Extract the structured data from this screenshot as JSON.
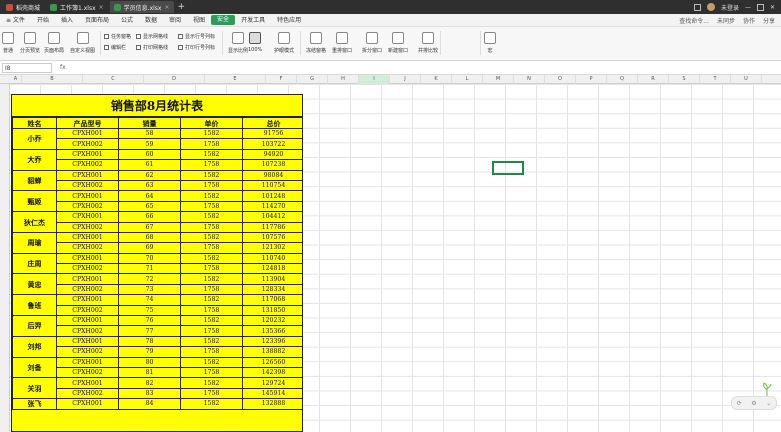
{
  "tabs": [
    {
      "label": "稻壳商城"
    },
    {
      "label": "工作簿1.xlsx"
    },
    {
      "label": "学员信息.xlsx"
    }
  ],
  "titlebar_user": "未登录",
  "menu": [
    "≡ 文件",
    "开始",
    "插入",
    "页面布局",
    "公式",
    "数据",
    "审阅",
    "视图",
    "安全",
    "开发工具",
    "特色应用"
  ],
  "menu_active_index": 8,
  "menu_right": [
    "查找命令...",
    "未同步",
    "协作",
    "分享"
  ],
  "ribbon": {
    "large": [
      {
        "label": "普通"
      },
      {
        "label": "分页预览"
      },
      {
        "label": "页面布局"
      },
      {
        "label": "自定义视图"
      },
      {
        "label": "显示比例"
      },
      {
        "label": "100%"
      },
      {
        "label": "护眼模式"
      },
      {
        "label": "冻结窗格"
      },
      {
        "label": "重排窗口"
      },
      {
        "label": "拆分窗口"
      },
      {
        "label": "新建窗口"
      },
      {
        "label": "并排比较"
      },
      {
        "label": "宏"
      }
    ],
    "checks": [
      "任务窗格",
      "编辑栏",
      "显示网格线",
      "打印网格线",
      "显示行号列标",
      "打印行号列标"
    ]
  },
  "formula": {
    "namebox": "I8",
    "fx": "fx"
  },
  "columns": [
    "A",
    "B",
    "C",
    "D",
    "E",
    "F",
    "G",
    "H",
    "I",
    "J",
    "K",
    "L",
    "M",
    "N",
    "O",
    "P",
    "Q",
    "R",
    "S",
    "T",
    "U",
    "V",
    "W",
    "X",
    "Y"
  ],
  "selected_column": "I",
  "sheet_title": "销售部8月统计表",
  "headers": [
    "姓名",
    "产品型号",
    "销量",
    "单价",
    "总价"
  ],
  "groups": [
    {
      "name": "小乔",
      "rows": [
        [
          "CPXH001",
          "58",
          "1582",
          "91756"
        ],
        [
          "CPXH002",
          "59",
          "1758",
          "103722"
        ]
      ]
    },
    {
      "name": "大乔",
      "rows": [
        [
          "CPXH001",
          "60",
          "1582",
          "94920"
        ],
        [
          "CPXH002",
          "61",
          "1758",
          "107238"
        ]
      ]
    },
    {
      "name": "貂蝉",
      "rows": [
        [
          "CPXH001",
          "62",
          "1582",
          "98084"
        ],
        [
          "CPXH002",
          "63",
          "1758",
          "110754"
        ]
      ]
    },
    {
      "name": "甄姬",
      "rows": [
        [
          "CPXH001",
          "64",
          "1582",
          "101248"
        ],
        [
          "CPXH002",
          "65",
          "1758",
          "114270"
        ]
      ]
    },
    {
      "name": "狄仁杰",
      "rows": [
        [
          "CPXH001",
          "66",
          "1582",
          "104412"
        ],
        [
          "CPXH002",
          "67",
          "1758",
          "117786"
        ]
      ]
    },
    {
      "name": "周瑜",
      "rows": [
        [
          "CPXH001",
          "68",
          "1582",
          "107576"
        ],
        [
          "CPXH002",
          "69",
          "1758",
          "121302"
        ]
      ]
    },
    {
      "name": "庄周",
      "rows": [
        [
          "CPXH001",
          "70",
          "1582",
          "110740"
        ],
        [
          "CPXH002",
          "71",
          "1758",
          "124818"
        ]
      ]
    },
    {
      "name": "黄忠",
      "rows": [
        [
          "CPXH001",
          "72",
          "1582",
          "113904"
        ],
        [
          "CPXH002",
          "73",
          "1758",
          "128334"
        ]
      ]
    },
    {
      "name": "鲁班",
      "rows": [
        [
          "CPXH001",
          "74",
          "1582",
          "117068"
        ],
        [
          "CPXH002",
          "75",
          "1758",
          "131850"
        ]
      ]
    },
    {
      "name": "后羿",
      "rows": [
        [
          "CPXH001",
          "76",
          "1582",
          "120232"
        ],
        [
          "CPXH002",
          "77",
          "1758",
          "135366"
        ]
      ]
    },
    {
      "name": "刘邦",
      "rows": [
        [
          "CPXH001",
          "78",
          "1582",
          "123396"
        ],
        [
          "CPXH002",
          "79",
          "1758",
          "138882"
        ]
      ]
    },
    {
      "name": "刘备",
      "rows": [
        [
          "CPXH001",
          "80",
          "1582",
          "126560"
        ],
        [
          "CPXH002",
          "81",
          "1758",
          "142398"
        ]
      ]
    },
    {
      "name": "关羽",
      "rows": [
        [
          "CPXH001",
          "82",
          "1582",
          "129724"
        ],
        [
          "CPXH002",
          "83",
          "1758",
          "145914"
        ]
      ]
    },
    {
      "name": "张飞",
      "rows": [
        [
          "CPXH001",
          "84",
          "1582",
          "132888"
        ]
      ]
    }
  ],
  "colors": {
    "sheet_fill": "#ffff00",
    "accent": "#2a9d5b"
  }
}
